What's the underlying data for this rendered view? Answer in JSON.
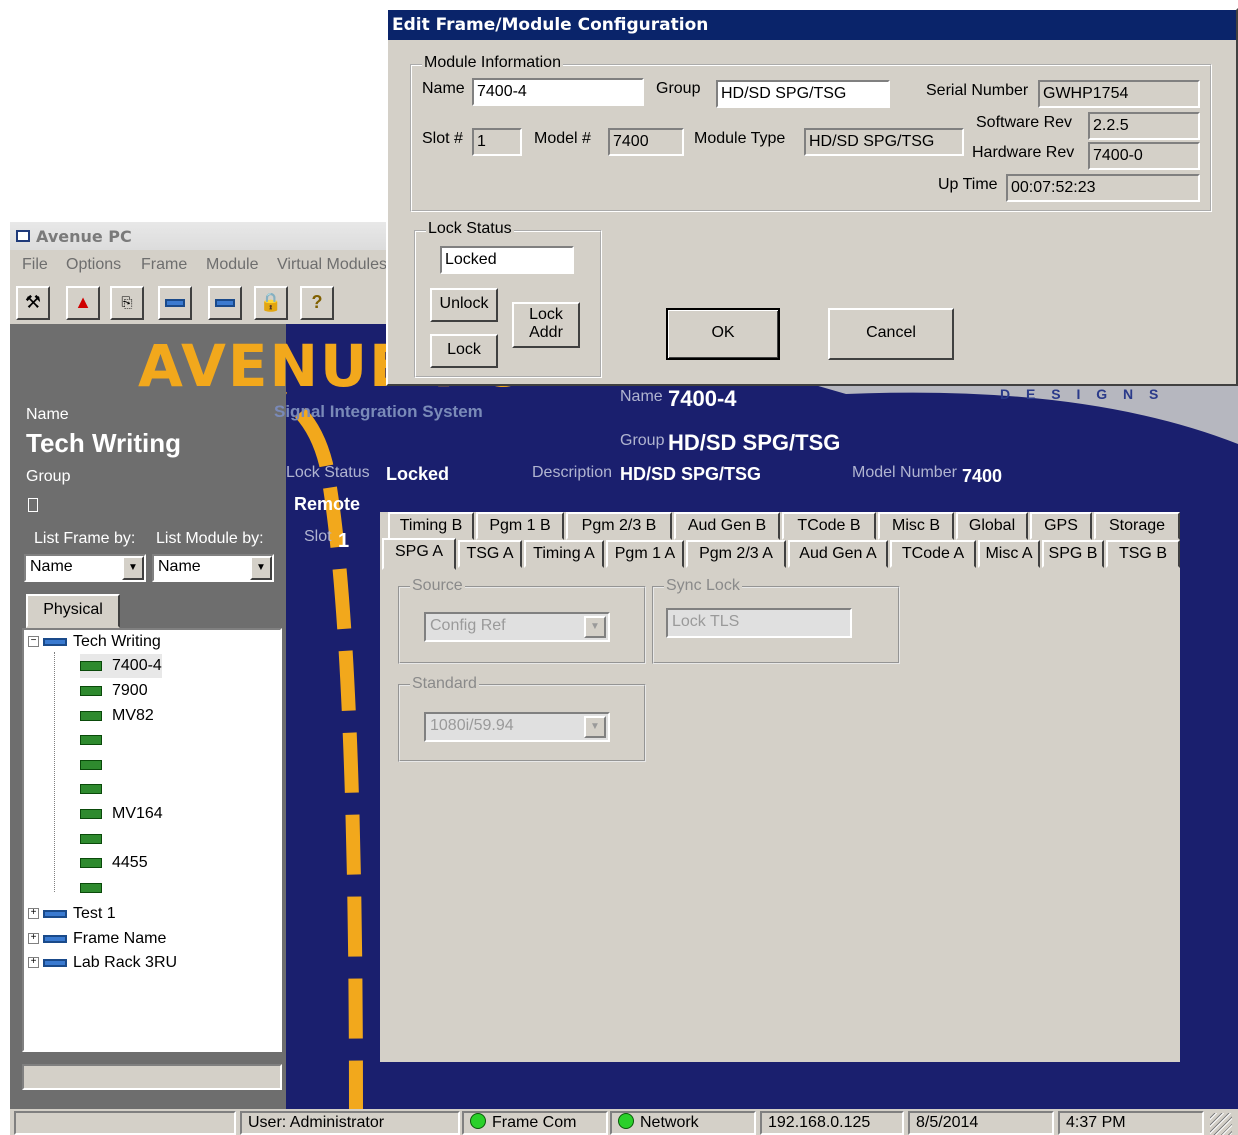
{
  "main_window": {
    "title": "Avenue PC",
    "menu": [
      "File",
      "Options",
      "Frame",
      "Module",
      "Virtual Modules"
    ],
    "toolbar_icons": [
      "tools-icon",
      "alert-icon",
      "frame-add-icon",
      "frame-icon",
      "module-icon",
      "lock-icon",
      "help-icon"
    ]
  },
  "left_panel": {
    "name_label": "Name",
    "name_value": "Tech Writing",
    "group_label": "Group",
    "group_value": "",
    "list_frame_label": "List Frame by:",
    "list_module_label": "List Module by:",
    "list_frame_value": "Name",
    "list_module_value": "Name",
    "physical_tab": "Physical",
    "tree": {
      "root": "Tech Writing",
      "modules": [
        "7400-4",
        "7900",
        "MV82",
        "",
        "",
        "",
        "MV164",
        "",
        "4455",
        ""
      ],
      "frames": [
        "Test 1",
        "Frame Name",
        "Lab Rack 3RU"
      ]
    }
  },
  "banner": {
    "logo_text": "AVENUE PC",
    "tagline": "Signal Integration System",
    "designs_text": "D E S I G N S",
    "lock_status_label": "Lock Status",
    "lock_status_value": "Locked",
    "remote_label": "Remote",
    "slot_label": "Slot",
    "slot_value": "1",
    "name_label": "Name",
    "name_value": "7400-4",
    "group_label": "Group",
    "group_value": "HD/SD SPG/TSG",
    "description_label": "Description",
    "description_value": "HD/SD SPG/TSG",
    "model_label": "Model Number",
    "model_value": "7400"
  },
  "tabs": {
    "row_back": [
      "Timing B",
      "Pgm 1 B",
      "Pgm 2/3 B",
      "Aud Gen B",
      "TCode B",
      "Misc B",
      "Global",
      "GPS",
      "Storage"
    ],
    "row_front": [
      "SPG A",
      "TSG A",
      "Timing A",
      "Pgm 1 A",
      "Pgm 2/3 A",
      "Aud Gen A",
      "TCode A",
      "Misc A",
      "SPG B",
      "TSG B"
    ],
    "active": "SPG A",
    "source_label": "Source",
    "source_value": "Config Ref",
    "sync_lock_label": "Sync Lock",
    "sync_lock_value": "Lock TLS",
    "standard_label": "Standard",
    "standard_value": "1080i/59.94"
  },
  "status_bar": {
    "user": "User:  Administrator",
    "frame_com": "Frame Com",
    "network": "Network",
    "ip": "192.168.0.125",
    "date": "8/5/2014",
    "time": "4:37 PM"
  },
  "dialog": {
    "title": "Edit Frame/Module Configuration",
    "module_info_label": "Module Information",
    "name_label": "Name",
    "name_value": "7400-4",
    "group_label": "Group",
    "group_value": "HD/SD SPG/TSG",
    "serial_label": "Serial Number",
    "serial_value": "GWHP1754",
    "slot_label": "Slot #",
    "slot_value": "1",
    "model_label": "Model #",
    "model_value": "7400",
    "module_type_label": "Module Type",
    "module_type_value": "HD/SD SPG/TSG",
    "software_rev_label": "Software Rev",
    "software_rev_value": "2.2.5",
    "hardware_rev_label": "Hardware Rev",
    "hardware_rev_value": "7400-0",
    "uptime_label": "Up Time",
    "uptime_value": "00:07:52:23",
    "lock_status_label": "Lock Status",
    "lock_status_value": "Locked",
    "unlock_button": "Unlock",
    "lock_button": "Lock",
    "lock_addr_line1": "Lock",
    "lock_addr_line2": "Addr",
    "ok_button": "OK",
    "cancel_button": "Cancel"
  }
}
